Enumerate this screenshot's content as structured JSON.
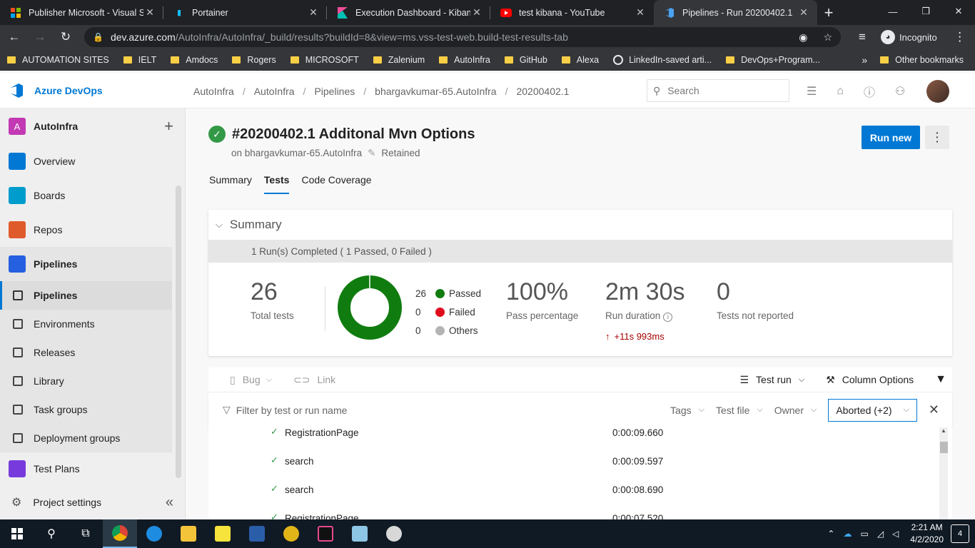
{
  "browser": {
    "tabs": [
      {
        "title": "Publisher Microsoft - Visual Stu",
        "icon": "microsoft-logo-icon"
      },
      {
        "title": "Portainer",
        "icon": "portainer-icon"
      },
      {
        "title": "Execution Dashboard - Kibana",
        "icon": "kibana-icon"
      },
      {
        "title": "test kibana - YouTube",
        "icon": "youtube-icon"
      },
      {
        "title": "Pipelines - Run 20200402.1",
        "icon": "azure-devops-icon",
        "active": true
      }
    ],
    "url_host": "dev.azure.com",
    "url_path": "/AutoInfra/AutoInfra/_build/results?buildId=8&view=ms.vss-test-web.build-test-results-tab",
    "incognito_label": "Incognito",
    "bookmarks": [
      "AUTOMATION SITES",
      "IELT",
      "Amdocs",
      "Rogers",
      "MICROSOFT",
      "Zalenium",
      "AutoInfra",
      "GitHub",
      "Alexa",
      "LinkedIn-saved arti...",
      "DevOps+Program..."
    ],
    "bookmarks_overflow": "»",
    "other_bookmarks": "Other bookmarks"
  },
  "header": {
    "product": "Azure DevOps",
    "breadcrumb": [
      "AutoInfra",
      "AutoInfra",
      "Pipelines",
      "bhargavkumar-65.AutoInfra",
      "20200402.1"
    ],
    "search_placeholder": "Search"
  },
  "sidebar": {
    "project_initial": "A",
    "project_name": "AutoInfra",
    "items": [
      {
        "label": "Overview",
        "color": "#0078d4"
      },
      {
        "label": "Boards",
        "color": "#009ccc"
      },
      {
        "label": "Repos",
        "color": "#e05b2b"
      },
      {
        "label": "Pipelines",
        "color": "#2560e0"
      }
    ],
    "pipeline_sub": [
      "Pipelines",
      "Environments",
      "Releases",
      "Library",
      "Task groups",
      "Deployment groups"
    ],
    "test_plans": "Test Plans",
    "project_settings": "Project settings"
  },
  "run": {
    "title": "#20200402.1 Additonal Mvn Options",
    "subtitle": "on bhargavkumar-65.AutoInfra",
    "retained": "Retained",
    "run_new": "Run new",
    "tabs": [
      "Summary",
      "Tests",
      "Code Coverage"
    ]
  },
  "summary": {
    "heading": "Summary",
    "runs_completed": "1 Run(s) Completed ( 1 Passed, 0 Failed )",
    "total_tests": "26",
    "total_tests_label": "Total tests",
    "passed_count": "26",
    "passed_label": "Passed",
    "passed_color": "#107c10",
    "failed_count": "0",
    "failed_label": "Failed",
    "failed_color": "#e00b1c",
    "others_count": "0",
    "others_label": "Others",
    "others_color": "#b4b4b4",
    "pass_pct": "100%",
    "pass_pct_label": "Pass percentage",
    "duration": "2m 30s",
    "duration_label": "Run duration",
    "duration_delta": "+11s 993ms",
    "not_reported": "0",
    "not_reported_label": "Tests not reported"
  },
  "toolbar": {
    "bug": "Bug",
    "link": "Link",
    "test_run": "Test run",
    "column_options": "Column Options"
  },
  "filters": {
    "placeholder": "Filter by test or run name",
    "tags": "Tags",
    "test_file": "Test file",
    "owner": "Owner",
    "outcome": "Aborted (+2)"
  },
  "results": [
    {
      "name": "RegistrationPage",
      "duration": "0:00:09.660"
    },
    {
      "name": "search",
      "duration": "0:00:09.597"
    },
    {
      "name": "search",
      "duration": "0:00:08.690"
    },
    {
      "name": "RegistrationPage",
      "duration": "0:00:07.520"
    }
  ],
  "taskbar": {
    "time": "2:21 AM",
    "date": "4/2/2020",
    "notifications": "4"
  }
}
